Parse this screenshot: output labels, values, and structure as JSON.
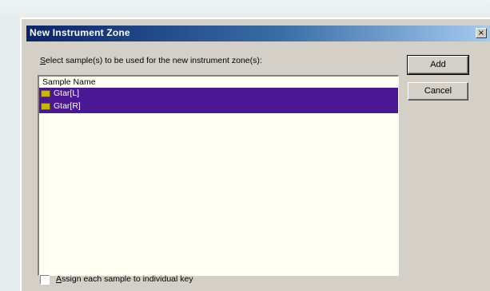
{
  "dialog": {
    "title": "New Instrument Zone",
    "close_glyph": "×"
  },
  "instruction": {
    "mnemonic": "S",
    "rest": "elect sample(s) to be used for the new instrument zone(s):"
  },
  "list": {
    "header": "Sample Name",
    "items": [
      {
        "label": "Gtar[L]",
        "icon": "sample-icon",
        "selected": true
      },
      {
        "label": "Gtar[R]",
        "icon": "sample-icon",
        "selected": true
      }
    ],
    "selection_color": "#4a1795"
  },
  "buttons": {
    "add_label": "Add",
    "cancel_label": "Cancel"
  },
  "checkbox": {
    "mnemonic": "A",
    "rest": "ssign each sample to individual key",
    "checked": false
  },
  "colors": {
    "dialog_bg": "#d4d0c8",
    "titlebar_start": "#0a246a",
    "titlebar_end": "#a6caf0",
    "listbox_bg": "#fffff4"
  }
}
